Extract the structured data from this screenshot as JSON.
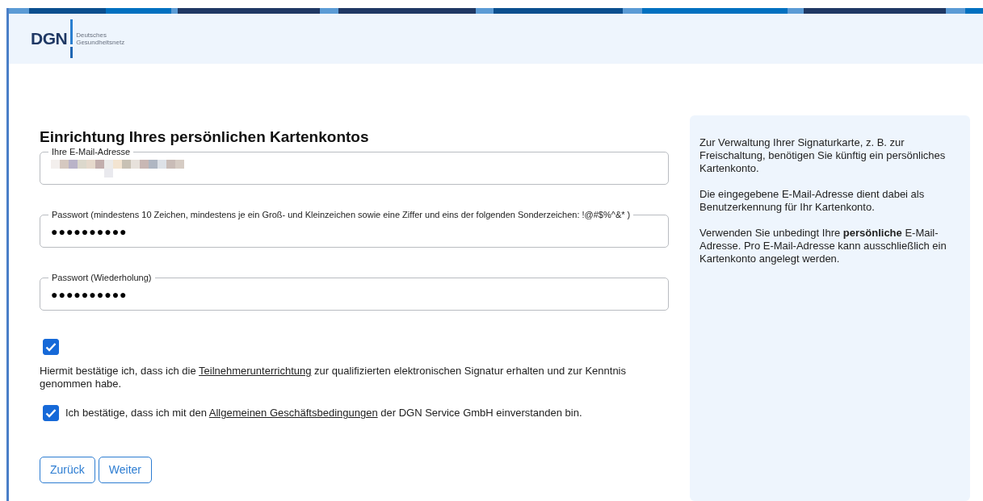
{
  "header": {
    "logo_mark": "DGN",
    "logo_text": [
      "Deutsches",
      "Gesundheitsnetz"
    ]
  },
  "form": {
    "title": "Einrichtung Ihres persönlichen Kartenkontos",
    "fields": [
      {
        "kind": "email",
        "label": "Ihre E-Mail-Adresse",
        "redacted": true
      },
      {
        "kind": "password",
        "label": "Passwort (mindestens 10 Zeichen, mindestens je ein Groß- und Kleinzeichen sowie eine Ziffer und eins der folgenden Sonderzeichen: !@#$%^&* )",
        "value": "●●●●●●●●●●"
      },
      {
        "kind": "password",
        "label": "Passwort (Wiederholung)",
        "value": "●●●●●●●●●●"
      }
    ],
    "consents": [
      {
        "kind": "stacked",
        "checked": true,
        "before": "Hiermit bestätige ich, dass ich die",
        "link": "Teilnehmerunterrichtung",
        "after": "zur qualifizierten elektronischen Signatur erhalten und zur Kenntnis genommen habe."
      },
      {
        "kind": "inline",
        "checked": true,
        "before": "Ich bestätige, dass ich mit den",
        "link": "Allgemeinen Geschäftsbedingungen",
        "after": "der DGN Service GmbH einverstanden bin."
      }
    ],
    "buttons": [
      "Zurück",
      "Weiter"
    ]
  },
  "info_panel": {
    "paragraphs": [
      "Zur Verwaltung Ihrer Signaturkarte, z. B. zur Freischaltung, benötigen Sie künftig ein persönliches Kartenkonto.",
      "Die eingegebene E-Mail-Adresse dient dabei als Benutzerkennung für Ihr Kartenkonto.",
      "Verwenden Sie unbedingt Ihre **persönliche** E-Mail-Adresse. Pro E-Mail-Adresse kann ausschließlich ein Kartenkonto angelegt werden."
    ]
  }
}
